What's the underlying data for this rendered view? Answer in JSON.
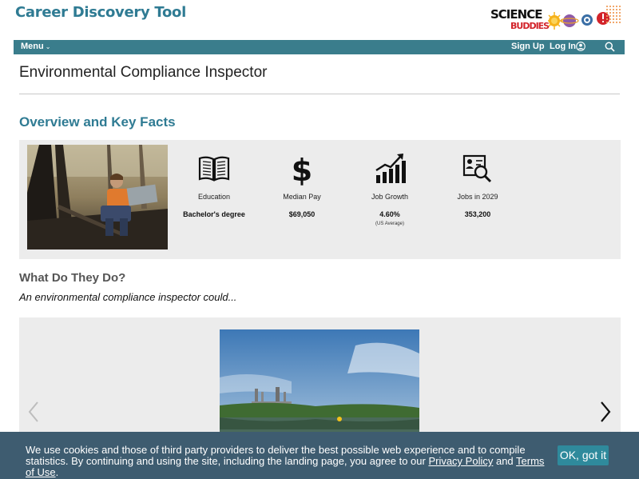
{
  "header": {
    "site_title": "Career Discovery Tool",
    "logo": {
      "line1": "SCIENCE",
      "line2": "BUDDIES"
    }
  },
  "nav": {
    "menu_label": "Menu",
    "sign_up": "Sign Up",
    "log_in": "Log In",
    "icons": [
      "chevron-down-icon",
      "user-circle-icon",
      "search-icon"
    ]
  },
  "page": {
    "title": "Environmental Compliance Inspector"
  },
  "overview": {
    "heading": "Overview and Key Facts",
    "facts": [
      {
        "icon": "open-book-icon",
        "label": "Education",
        "value": "Bachelor's degree"
      },
      {
        "icon": "dollar-sign-icon",
        "label": "Median Pay",
        "value": "$69,050"
      },
      {
        "icon": "growth-chart-icon",
        "label": "Job Growth",
        "value": "4.60%",
        "note": "(US Average)"
      },
      {
        "icon": "job-search-icon",
        "label": "Jobs in 2029",
        "value": "353,200"
      }
    ]
  },
  "what_they_do": {
    "heading": "What Do They Do?",
    "subheading": "An environmental compliance inspector could..."
  },
  "cookie": {
    "text_before": "We use cookies and those of third party providers to deliver the best possible web experience and to compile statistics. By continuing and using the site, including the landing page, you agree to our ",
    "privacy_link": "Privacy Policy",
    "text_between": " and ",
    "terms_link": "Terms of Use",
    "text_after": ".",
    "ok_label": "OK, got it"
  },
  "colors": {
    "brand_teal": "#2f7b93",
    "nav_bar": "#3a7d8c",
    "cookie_bar": "#3e5c70",
    "cookie_button": "#2f8a9c",
    "panel_gray": "#ececec"
  }
}
